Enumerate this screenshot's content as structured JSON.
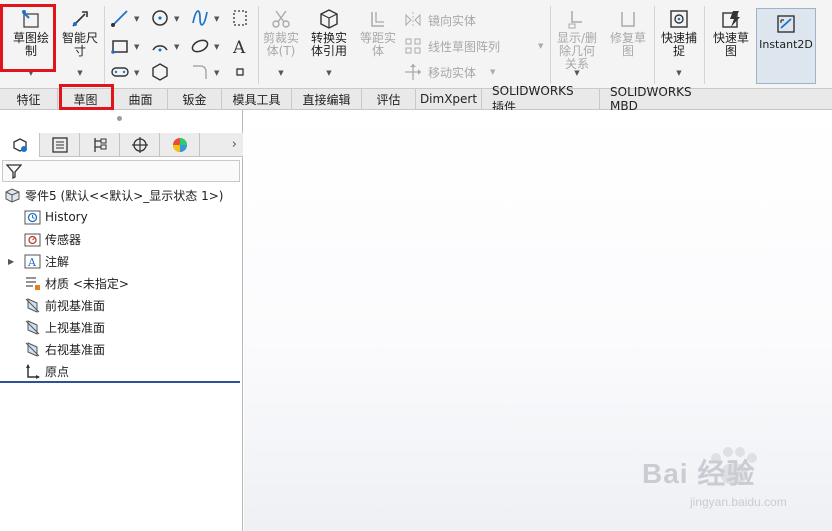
{
  "ribbon": {
    "sketch_label": "草图绘\n制",
    "smart_dim_label": "智能尺\n寸",
    "trim_label": "剪裁实\n体(T)",
    "convert_label": "转换实\n体引用",
    "offset_label": "等距实\n体",
    "mirror_label": "镜向实体",
    "linear_pattern_label": "线性草图阵列",
    "move_label": "移动实体",
    "show_relations_label": "显示/删\n除几何\n关系",
    "repair_label": "修复草\n图",
    "quick_snap_label": "快速捕\n捉",
    "rapid_sketch_label": "快速草\n图",
    "instant2d_label": "Instant2D"
  },
  "tabs": [
    {
      "label": "特征"
    },
    {
      "label": "草图"
    },
    {
      "label": "曲面"
    },
    {
      "label": "钣金"
    },
    {
      "label": "模具工具"
    },
    {
      "label": "直接编辑"
    },
    {
      "label": "评估"
    },
    {
      "label": "DimXpert"
    },
    {
      "label": "SOLIDWORKS 插件"
    },
    {
      "label": "SOLIDWORKS MBD"
    }
  ],
  "tree": {
    "root": "零件5  (默认<<默认>_显示状态 1>)",
    "items": [
      {
        "label": "History"
      },
      {
        "label": "传感器"
      },
      {
        "label": "注解"
      },
      {
        "label": "材质 <未指定>"
      },
      {
        "label": "前视基准面"
      },
      {
        "label": "上视基准面"
      },
      {
        "label": "右视基准面"
      },
      {
        "label": "原点"
      }
    ]
  },
  "watermark": {
    "brand": "Bai  经验",
    "url": "jingyan.baidu.com"
  },
  "colors": {
    "highlight": "#e0141b",
    "active_tab_border": "#e0141b",
    "tree_end": "#2c4f9e"
  }
}
